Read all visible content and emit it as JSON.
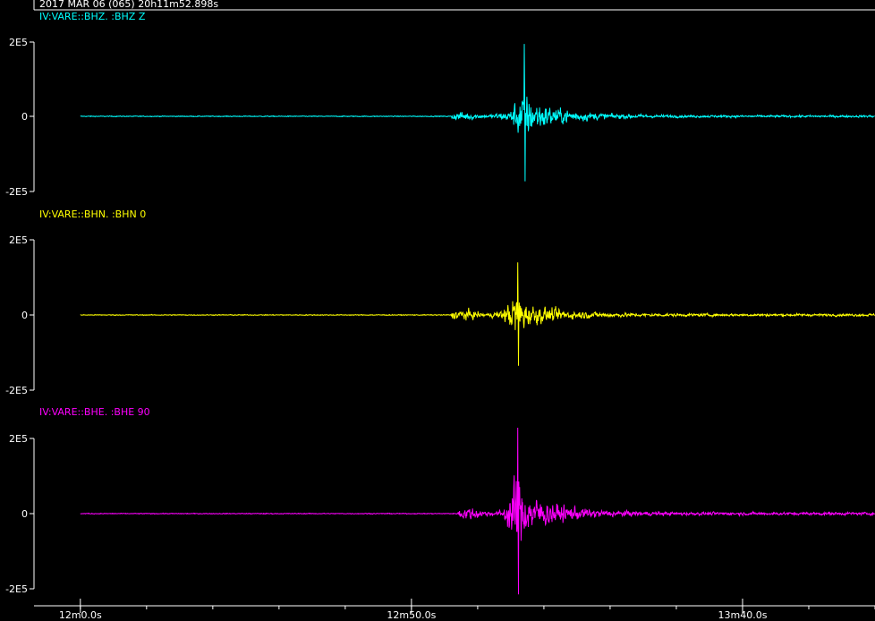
{
  "header": {
    "datetime": "2017 MAR 06 (065)  20h11m52.898s"
  },
  "chart_data": [
    {
      "type": "line",
      "title": "IV:VARE::BHZ.  :BHZ Z",
      "color": "#00ffff",
      "yticks": [
        "2E5",
        "0",
        "-2E5"
      ],
      "ylim": [
        -200000,
        200000
      ],
      "onset_s": 56,
      "peak_s": 67,
      "peak_max": 195000,
      "peak_min": -175000,
      "noise_amp": 2500,
      "coda_amp": 12000
    },
    {
      "type": "line",
      "title": "IV:VARE::BHN.  :BHN 0",
      "color": "#ffff00",
      "yticks": [
        "2E5",
        "0",
        "-2E5"
      ],
      "ylim": [
        -200000,
        200000
      ],
      "onset_s": 56,
      "peak_s": 66,
      "peak_max": 140000,
      "peak_min": -135000,
      "noise_amp": 2500,
      "coda_amp": 14000
    },
    {
      "type": "line",
      "title": "IV:VARE::BHE.  :BHE 90",
      "color": "#ff00ff",
      "yticks": [
        "2E5",
        "0",
        "-2E5"
      ],
      "ylim": [
        -200000,
        200000
      ],
      "onset_s": 57,
      "peak_s": 66,
      "peak_max": 250000,
      "peak_min": -215000,
      "noise_amp": 2500,
      "coda_amp": 16000
    }
  ],
  "x_axis": {
    "ticks": [
      {
        "t": 0,
        "label": "12m0.0s"
      },
      {
        "t": 50,
        "label": "12m50.0s"
      },
      {
        "t": 100,
        "label": "13m40.0s"
      }
    ],
    "minor_step": 10,
    "xlim": [
      -7,
      120
    ]
  }
}
